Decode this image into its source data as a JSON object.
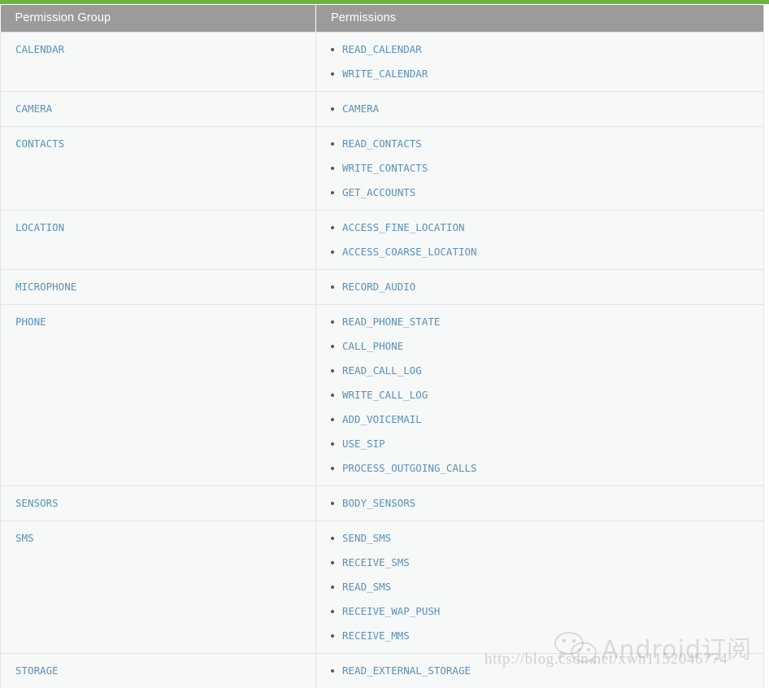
{
  "accent_color": "#6eb23f",
  "header_bg": "#9a9b9a",
  "link_color": "#5b91b8",
  "table": {
    "columns": [
      {
        "label": "Permission Group"
      },
      {
        "label": "Permissions"
      }
    ],
    "rows": [
      {
        "group": "CALENDAR",
        "permissions": [
          "READ_CALENDAR",
          "WRITE_CALENDAR"
        ]
      },
      {
        "group": "CAMERA",
        "permissions": [
          "CAMERA"
        ]
      },
      {
        "group": "CONTACTS",
        "permissions": [
          "READ_CONTACTS",
          "WRITE_CONTACTS",
          "GET_ACCOUNTS"
        ]
      },
      {
        "group": "LOCATION",
        "permissions": [
          "ACCESS_FINE_LOCATION",
          "ACCESS_COARSE_LOCATION"
        ]
      },
      {
        "group": "MICROPHONE",
        "permissions": [
          "RECORD_AUDIO"
        ]
      },
      {
        "group": "PHONE",
        "permissions": [
          "READ_PHONE_STATE",
          "CALL_PHONE",
          "READ_CALL_LOG",
          "WRITE_CALL_LOG",
          "ADD_VOICEMAIL",
          "USE_SIP",
          "PROCESS_OUTGOING_CALLS"
        ]
      },
      {
        "group": "SENSORS",
        "permissions": [
          "BODY_SENSORS"
        ]
      },
      {
        "group": "SMS",
        "permissions": [
          "SEND_SMS",
          "RECEIVE_SMS",
          "READ_SMS",
          "RECEIVE_WAP_PUSH",
          "RECEIVE_MMS"
        ]
      },
      {
        "group": "STORAGE",
        "permissions": [
          "READ_EXTERNAL_STORAGE"
        ]
      }
    ]
  },
  "watermarks": {
    "logo_text": "Android订阅",
    "logo_icon": "wechat-icon",
    "url": "http://blog.csdn.net/xwh1152046774"
  }
}
